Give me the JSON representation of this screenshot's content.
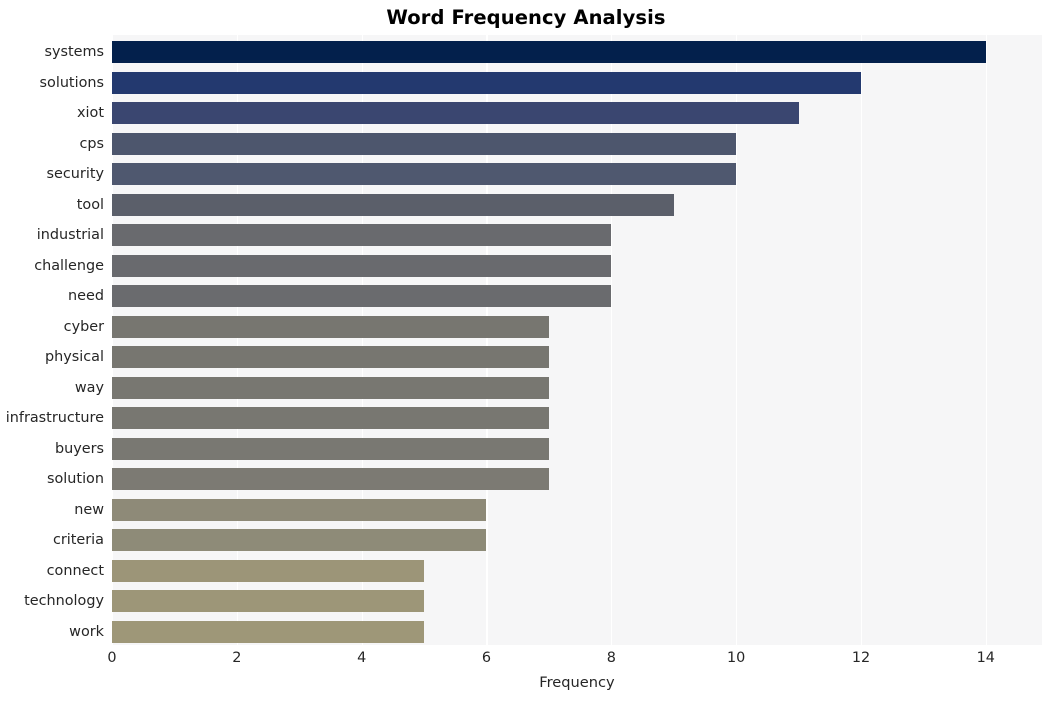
{
  "chart_data": {
    "type": "bar",
    "orientation": "horizontal",
    "title": "Word Frequency Analysis",
    "xlabel": "Frequency",
    "ylabel": "",
    "categories": [
      "systems",
      "solutions",
      "xiot",
      "cps",
      "security",
      "tool",
      "industrial",
      "challenge",
      "need",
      "cyber",
      "physical",
      "way",
      "infrastructure",
      "buyers",
      "solution",
      "new",
      "criteria",
      "connect",
      "technology",
      "work"
    ],
    "values": [
      14,
      12,
      11,
      10,
      10,
      9,
      8,
      8,
      8,
      7,
      7,
      7,
      7,
      7,
      7,
      6,
      6,
      5,
      5,
      5
    ],
    "xticks": [
      0,
      2,
      4,
      6,
      8,
      10,
      12,
      14
    ],
    "xlim": [
      0,
      14.9
    ],
    "grid": "vertical-only",
    "legend": "none",
    "bar_colors": [
      "#03204c",
      "#23396f",
      "#3a4670",
      "#4d566d",
      "#4f586f",
      "#5b5f6a",
      "#696a6e",
      "#696a6e",
      "#6a6b6e",
      "#777670",
      "#777670",
      "#787771",
      "#787771",
      "#797872",
      "#7c7a73",
      "#8e8a78",
      "#8e8b78",
      "#9c9578",
      "#9d9678",
      "#9e9778"
    ],
    "plot_background": "#f6f6f7",
    "gridline_color": "#ffffff",
    "figure_background": "#ffffff",
    "text_color": "#262626"
  }
}
